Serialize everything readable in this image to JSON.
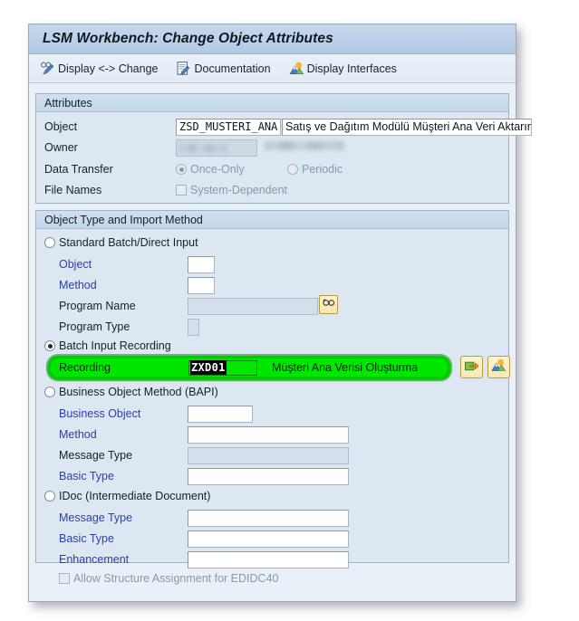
{
  "window": {
    "title": "LSM Workbench: Change Object Attributes"
  },
  "toolbar": {
    "items": [
      {
        "label": "Display <-> Change",
        "icon": "glasses-pencil-icon"
      },
      {
        "label": "Documentation",
        "icon": "document-pencil-icon"
      },
      {
        "label": "Display Interfaces",
        "icon": "mountains-sun-icon"
      }
    ]
  },
  "attributes": {
    "header": "Attributes",
    "object_label": "Object",
    "object_value": "ZSD_MUSTERI_ANA",
    "object_description": "Satış ve Dağıtım Modülü Müşteri Ana Veri Aktarımı",
    "owner_label": "Owner",
    "owner_value": "",
    "owner_description": "",
    "data_transfer_label": "Data Transfer",
    "data_transfer_once_only": "Once-Only",
    "data_transfer_periodic": "Periodic",
    "file_names_label": "File Names",
    "file_names_system_dependent": "System-Dependent"
  },
  "object_type": {
    "header": "Object Type and Import Method",
    "standard": {
      "radio_label": "Standard Batch/Direct Input",
      "object_label": "Object",
      "object_value": "",
      "method_label": "Method",
      "method_value": "",
      "program_name_label": "Program Name",
      "program_name_value": "",
      "program_type_label": "Program Type",
      "program_type_value": "",
      "search_help_icon": "glasses-icon"
    },
    "batch_input": {
      "radio_label": "Batch Input Recording",
      "recording_label": "Recording",
      "recording_value": "ZXD01",
      "recording_description": "Müşteri Ana Verisi Oluşturma",
      "goto_button_icon": "goto-recording-icon",
      "overview_button_icon": "mountains-sun-icon"
    },
    "bapi": {
      "radio_label": "Business Object Method  (BAPI)",
      "business_object_label": "Business Object",
      "business_object_value": "",
      "method_label": "Method",
      "method_value": "",
      "message_type_label": "Message Type",
      "message_type_value": "",
      "basic_type_label": "Basic Type",
      "basic_type_value": ""
    },
    "idoc": {
      "radio_label": "IDoc (Intermediate Document)",
      "message_type_label": "Message Type",
      "message_type_value": "",
      "basic_type_label": "Basic Type",
      "basic_type_value": "",
      "enhancement_label": "Enhancement",
      "enhancement_value": "",
      "allow_structure_label": "Allow Structure Assignment for EDIDC40"
    }
  },
  "colors": {
    "title_bar": "#bdd2e9",
    "panel_bg": "#eaf0f7",
    "group_bg": "#dde7f1",
    "highlight_green": "#00e600",
    "link_blue": "#2c3fa8"
  }
}
